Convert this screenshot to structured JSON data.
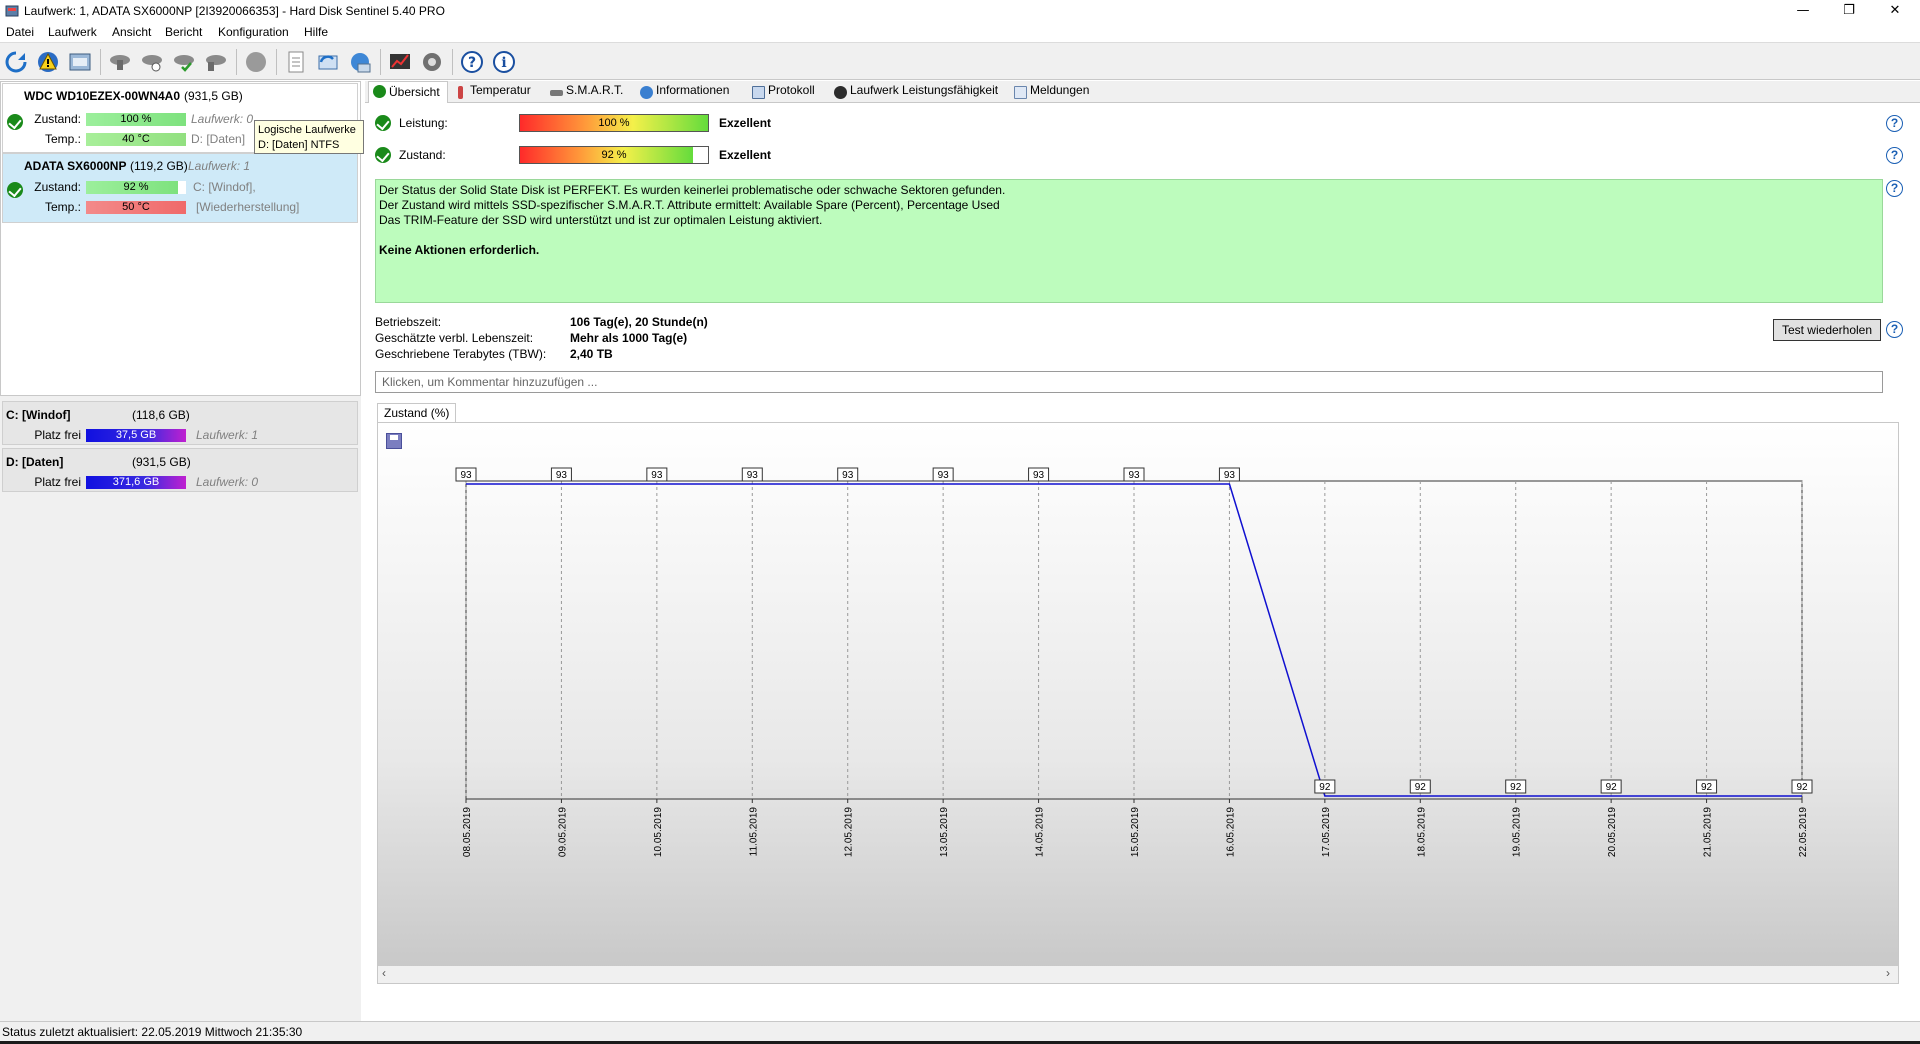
{
  "window": {
    "title": "Laufwerk: 1, ADATA SX6000NP [2I3920066353]  -  Hard Disk Sentinel 5.40 PRO",
    "minimize": "—",
    "maximize": "❐",
    "close": "✕"
  },
  "menu": [
    "Datei",
    "Laufwerk",
    "Ansicht",
    "Bericht",
    "Konfiguration",
    "Hilfe"
  ],
  "toolbar": {
    "icons": [
      "refresh-icon",
      "alert-icon",
      "report-icon",
      "disk-tool-icon",
      "disk-test-icon",
      "disk-check-icon",
      "disk-erase-icon",
      "disk-surface-icon",
      "document-icon",
      "send-report-icon",
      "network-icon",
      "performance-icon",
      "tools-icon",
      "help-icon",
      "info-icon"
    ]
  },
  "disks": [
    {
      "name": "WDC WD10EZEX-00WN4A0",
      "size": "(931,5 GB)",
      "status_label": "Zustand:",
      "status_value": "100 %",
      "status_fraction": 1.0,
      "temp_label": "Temp.:",
      "temp_value": "40 °C",
      "drive_ref": "Laufwerk: 0",
      "partition": "D: [Daten]"
    },
    {
      "name": "ADATA SX6000NP",
      "size": "(119,2 GB)",
      "drive_ref": "Laufwerk: 1",
      "status_label": "Zustand:",
      "status_value": "92 %",
      "status_fraction": 0.92,
      "temp_label": "Temp.:",
      "temp_value": "50 °C",
      "partition": "C: [Windof],",
      "partition2": "[Wiederherstellung]"
    }
  ],
  "tooltip": {
    "line1": "Logische Laufwerke",
    "line2": "D: [Daten] NTFS"
  },
  "volumes": [
    {
      "name": "C: [Windof]",
      "size": "(118,6 GB)",
      "free_label": "Platz frei",
      "free_value": "37,5 GB",
      "drive_ref": "Laufwerk: 1"
    },
    {
      "name": "D: [Daten]",
      "size": "(931,5 GB)",
      "free_label": "Platz frei",
      "free_value": "371,6 GB",
      "drive_ref": "Laufwerk: 0"
    }
  ],
  "tabs": [
    "Übersicht",
    "Temperatur",
    "S.M.A.R.T.",
    "Informationen",
    "Protokoll",
    "Laufwerk Leistungsfähigkeit",
    "Meldungen"
  ],
  "overview": {
    "performance_label": "Leistung:",
    "performance_value": "100 %",
    "performance_fraction": 1.0,
    "performance_rating": "Exzellent",
    "health_label": "Zustand:",
    "health_value": "92 %",
    "health_fraction": 0.92,
    "health_rating": "Exzellent",
    "status_lines": [
      "Der Status der Solid State Disk ist PERFEKT. Es wurden keinerlei problematische oder schwache Sektoren gefunden.",
      "Der Zustand wird mittels SSD-spezifischer S.M.A.R.T. Attribute ermittelt:  Available Spare (Percent), Percentage Used",
      "Das TRIM-Feature der SSD wird unterstützt und ist zur optimalen Leistung aktiviert."
    ],
    "status_action": "Keine Aktionen erforderlich.",
    "uptime_label": "Betriebszeit:",
    "uptime_value": "106 Tag(e), 20 Stunde(n)",
    "lifetime_label": "Geschätzte verbl. Lebenszeit:",
    "lifetime_value": "Mehr als 1000 Tag(e)",
    "tbw_label": "Geschriebene Terabytes (TBW):",
    "tbw_value": "2,40 TB",
    "retest_button": "Test wiederholen",
    "comment_placeholder": "Klicken, um Kommentar hinzuzufügen ...",
    "help": "?"
  },
  "chart_tab": "Zustand (%)",
  "chart_data": {
    "type": "line",
    "title": "Zustand (%)",
    "x": [
      "08.05.2019",
      "09.05.2019",
      "10.05.2019",
      "11.05.2019",
      "12.05.2019",
      "13.05.2019",
      "14.05.2019",
      "15.05.2019",
      "16.05.2019",
      "17.05.2019",
      "18.05.2019",
      "19.05.2019",
      "20.05.2019",
      "21.05.2019",
      "22.05.2019"
    ],
    "series": [
      {
        "values": [
          93,
          93,
          93,
          93,
          93,
          93,
          93,
          93,
          93,
          92,
          92,
          92,
          92,
          92,
          92
        ]
      }
    ],
    "ylim": [
      92,
      93
    ],
    "grid": "vertical dashed",
    "line_color": "#1010d0"
  },
  "statusbar": {
    "text": "Status zuletzt aktualisiert: 22.05.2019 Mittwoch 21:35:30"
  }
}
